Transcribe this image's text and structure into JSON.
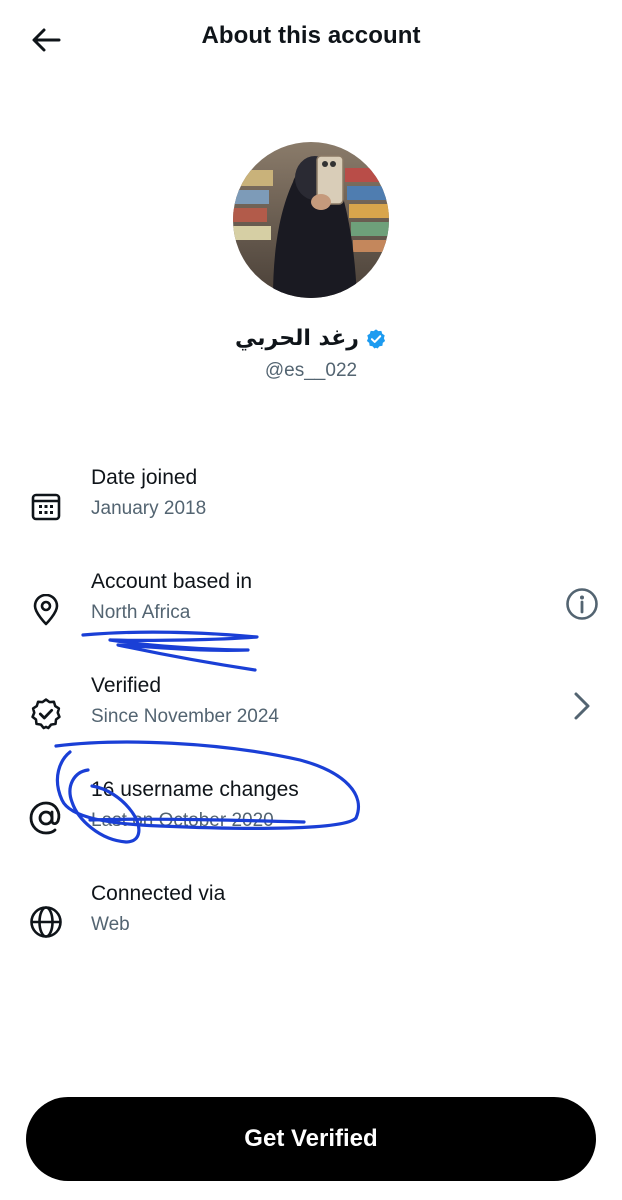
{
  "header": {
    "title": "About this account",
    "back_icon": "arrow-left-icon"
  },
  "profile": {
    "display_name": "رغد الحربي",
    "handle": "@es__022",
    "verified_badge_color": "#1d9bf0"
  },
  "rows": [
    {
      "icon": "calendar-icon",
      "title": "Date joined",
      "subtitle": "January 2018"
    },
    {
      "icon": "location-pin-icon",
      "title": "Account based in",
      "subtitle": "North Africa",
      "action_icon": "info-icon"
    },
    {
      "icon": "verified-badge-icon",
      "title": "Verified",
      "subtitle": "Since November 2024",
      "action_icon": "chevron-right-icon"
    },
    {
      "icon": "at-sign-icon",
      "title": "16 username changes",
      "subtitle": "Last on October 2020"
    },
    {
      "icon": "globe-icon",
      "title": "Connected via",
      "subtitle": "Web"
    }
  ],
  "annotation_color": "#1a3fd6",
  "cta": {
    "label": "Get Verified"
  }
}
